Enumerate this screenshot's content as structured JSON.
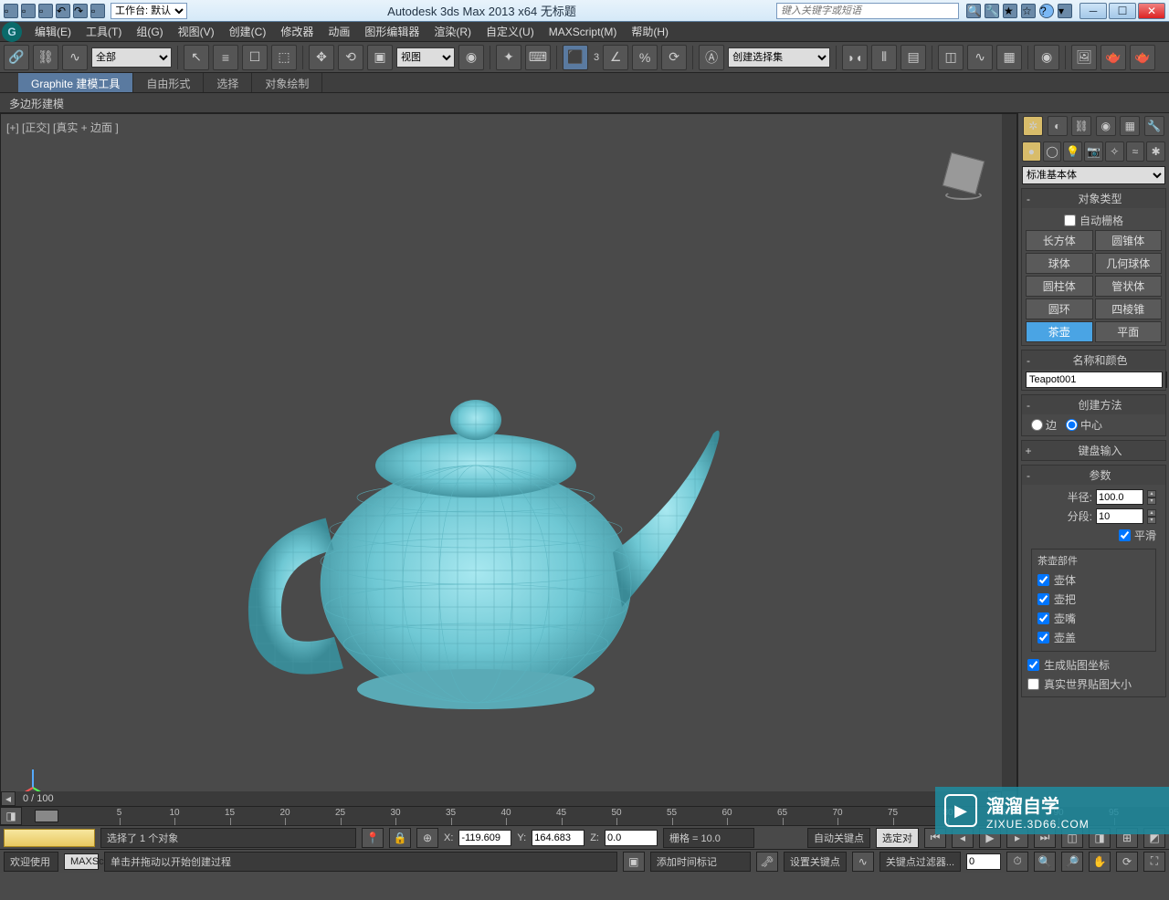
{
  "titlebar": {
    "workspace_label": "工作台: 默认",
    "app_title": "Autodesk 3ds Max  2013 x64     无标题",
    "search_placeholder": "键入关键字或短语"
  },
  "menus": {
    "edit": "编辑(E)",
    "tools": "工具(T)",
    "group": "组(G)",
    "views": "视图(V)",
    "create": "创建(C)",
    "modifiers": "修改器",
    "animation": "动画",
    "grapheditors": "图形编辑器",
    "render": "渲染(R)",
    "customize": "自定义(U)",
    "maxscript": "MAXScript(M)",
    "help": "帮助(H)"
  },
  "toolbar": {
    "filter_all": "全部",
    "view_dd": "视图",
    "selset_dd": "创建选择集"
  },
  "ribbon": {
    "tab_graphite": "Graphite 建模工具",
    "tab_freeform": "自由形式",
    "tab_select": "选择",
    "tab_objectpaint": "对象绘制",
    "sub_poly": "多边形建模"
  },
  "viewport": {
    "label": "[+] [正交] [真实 + 边面 ]",
    "frames": "0 / 100"
  },
  "panel": {
    "stdprim": "标准基本体",
    "objtype_hd": "对象类型",
    "autogrid": "自动栅格",
    "btns": {
      "box": "长方体",
      "cone": "圆锥体",
      "sphere": "球体",
      "geosphere": "几何球体",
      "cylinder": "圆柱体",
      "tube": "管状体",
      "torus": "圆环",
      "pyramid": "四棱锥",
      "teapot": "茶壶",
      "plane": "平面"
    },
    "namecolor_hd": "名称和颜色",
    "obj_name": "Teapot001",
    "createmethod_hd": "创建方法",
    "radio_edge": "边",
    "radio_center": "中心",
    "kbd_hd": "键盘输入",
    "params_hd": "参数",
    "radius_lbl": "半径:",
    "radius_val": "100.0",
    "segs_lbl": "分段:",
    "segs_val": "10",
    "smooth": "平滑",
    "parts_hd": "茶壶部件",
    "part_body": "壶体",
    "part_handle": "壶把",
    "part_spout": "壶嘴",
    "part_lid": "壶盖",
    "gen_uv": "生成贴图坐标",
    "real_world": "真实世界贴图大小"
  },
  "timeline": {
    "ticks": [
      "5",
      "10",
      "15",
      "20",
      "25",
      "30",
      "35",
      "40",
      "45",
      "50",
      "55",
      "60",
      "65",
      "70",
      "75",
      "80",
      "85",
      "90",
      "95"
    ]
  },
  "status": {
    "sel_info": "选择了 1 个对象",
    "x_lbl": "X:",
    "x_val": "-119.609",
    "y_lbl": "Y:",
    "y_val": "164.683",
    "z_lbl": "Z:",
    "z_val": "0.0",
    "grid": "栅格 = 10.0",
    "autokey": "自动关键点",
    "selkey": "选定对",
    "welcome": "欢迎使用",
    "maxsc": "MAXSci",
    "prompt": "单击并拖动以开始创建过程",
    "addtm": "添加时间标记",
    "setkey": "设置关键点",
    "keyfilter": "关键点过滤器..."
  },
  "watermark": {
    "cn": "溜溜自学",
    "en": "ZIXUE.3D66.COM"
  }
}
